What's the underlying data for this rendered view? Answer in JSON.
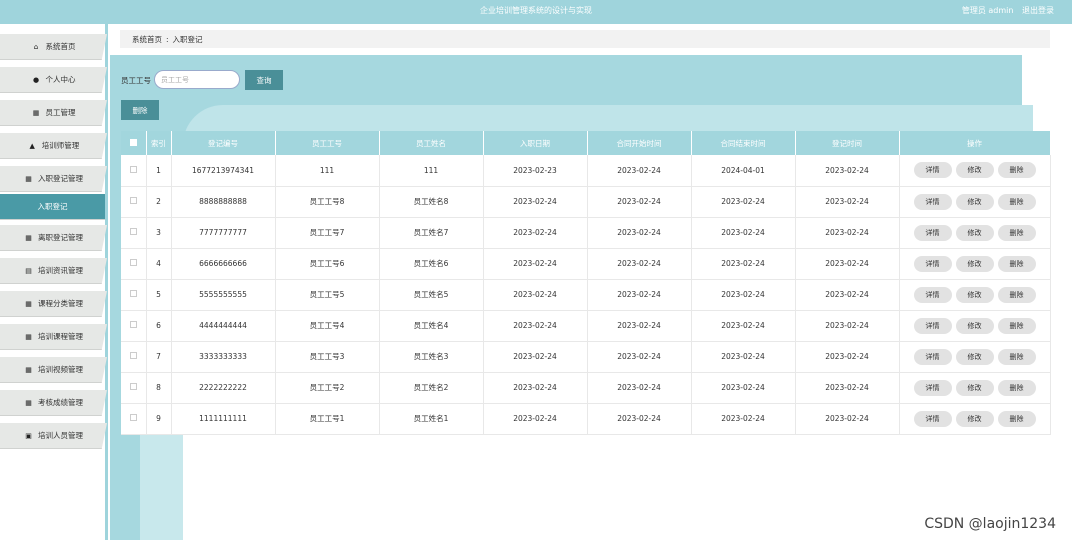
{
  "header": {
    "title": "企业培训管理系统的设计与实现",
    "user_role": "管理员 admin",
    "logout": "退出登录"
  },
  "sidebar": {
    "items": [
      {
        "label": "系统首页",
        "icon": "home-icon",
        "glyph": "⌂"
      },
      {
        "label": "个人中心",
        "icon": "user-icon",
        "glyph": "●"
      },
      {
        "label": "员工管理",
        "icon": "grid-icon",
        "glyph": "▦"
      },
      {
        "label": "培训师管理",
        "icon": "lock-icon",
        "glyph": "▲"
      },
      {
        "label": "入职登记管理",
        "icon": "grid-icon",
        "glyph": "▦"
      },
      {
        "label": "入职登记",
        "icon": "",
        "glyph": ""
      },
      {
        "label": "离职登记管理",
        "icon": "grid-icon",
        "glyph": "▦"
      },
      {
        "label": "培训资讯管理",
        "icon": "doc-icon",
        "glyph": "▤"
      },
      {
        "label": "课程分类管理",
        "icon": "grid-icon",
        "glyph": "▦"
      },
      {
        "label": "培训课程管理",
        "icon": "grid-icon",
        "glyph": "▦"
      },
      {
        "label": "培训视频管理",
        "icon": "grid-icon",
        "glyph": "▦"
      },
      {
        "label": "考核成绩管理",
        "icon": "grid-icon",
        "glyph": "▦"
      },
      {
        "label": "培训人员管理",
        "icon": "check-icon",
        "glyph": "▣"
      }
    ]
  },
  "breadcrumb": {
    "home": "系统首页",
    "sep": ":",
    "current": "入职登记"
  },
  "search": {
    "label": "员工工号",
    "placeholder": "员工工号",
    "query_label": "查询",
    "delete_label": "删除"
  },
  "table": {
    "headers": [
      "索引",
      "登记编号",
      "员工工号",
      "员工姓名",
      "入职日期",
      "合同开始时间",
      "合同结束时间",
      "登记时间",
      "操作"
    ],
    "actions": {
      "detail": "详情",
      "edit": "修改",
      "delete": "删除"
    },
    "rows": [
      [
        "1",
        "1677213974341",
        "111",
        "111",
        "2023-02-23",
        "2023-02-24",
        "2024-04-01",
        "2023-02-24"
      ],
      [
        "2",
        "8888888888",
        "员工工号8",
        "员工姓名8",
        "2023-02-24",
        "2023-02-24",
        "2023-02-24",
        "2023-02-24"
      ],
      [
        "3",
        "7777777777",
        "员工工号7",
        "员工姓名7",
        "2023-02-24",
        "2023-02-24",
        "2023-02-24",
        "2023-02-24"
      ],
      [
        "4",
        "6666666666",
        "员工工号6",
        "员工姓名6",
        "2023-02-24",
        "2023-02-24",
        "2023-02-24",
        "2023-02-24"
      ],
      [
        "5",
        "5555555555",
        "员工工号5",
        "员工姓名5",
        "2023-02-24",
        "2023-02-24",
        "2023-02-24",
        "2023-02-24"
      ],
      [
        "6",
        "4444444444",
        "员工工号4",
        "员工姓名4",
        "2023-02-24",
        "2023-02-24",
        "2023-02-24",
        "2023-02-24"
      ],
      [
        "7",
        "3333333333",
        "员工工号3",
        "员工姓名3",
        "2023-02-24",
        "2023-02-24",
        "2023-02-24",
        "2023-02-24"
      ],
      [
        "8",
        "2222222222",
        "员工工号2",
        "员工姓名2",
        "2023-02-24",
        "2023-02-24",
        "2023-02-24",
        "2023-02-24"
      ],
      [
        "9",
        "1111111111",
        "员工工号1",
        "员工姓名1",
        "2023-02-24",
        "2023-02-24",
        "2023-02-24",
        "2023-02-24"
      ]
    ]
  },
  "watermark": "CSDN @laojin1234",
  "colors": {
    "accent": "#9fd4dc",
    "button": "#4a8f98",
    "active_menu": "#4a9aa6"
  }
}
